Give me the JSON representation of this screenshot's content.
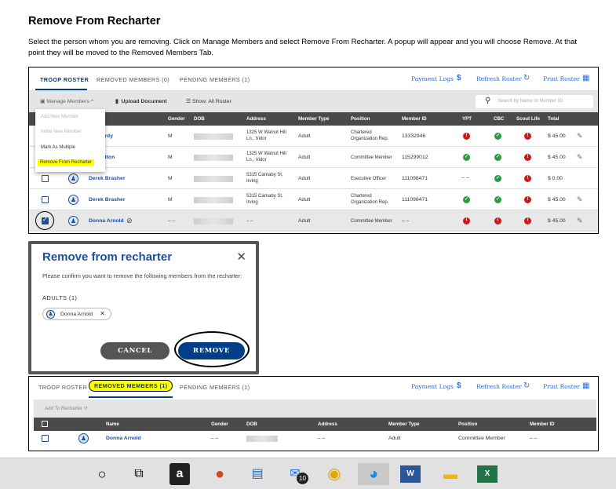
{
  "doc": {
    "title": "Remove From Recharter",
    "instructions": "Select the person whom you are removing. Click on Manage Members and select Remove From Recharter. A popup will appear and you will choose Remove. At that point they will be moved to the Removed Members Tab."
  },
  "roster": {
    "tabs": [
      "TROOP ROSTER",
      "REMOVED MEMBERS (0)",
      "PENDING MEMBERS (1)"
    ],
    "links": [
      "Payment Logs",
      "Refresh Roster",
      "Print Roster"
    ],
    "toolbar": {
      "manage": "Manage Members",
      "upload": "Upload Document",
      "show": "Show: All Roster",
      "search_placeholder": "Search by Name or Member ID"
    },
    "menu": [
      "Add New Member",
      "Invite New Member",
      "Mark As Multiple",
      "Remove From Recharter"
    ],
    "columns": [
      "Gender",
      "DOB",
      "Address",
      "Member Type",
      "Position",
      "Member ID",
      "YPT",
      "CBC",
      "Scout Life",
      "Total"
    ],
    "rows": [
      {
        "name": "...n Hardy",
        "gender": "M",
        "address": "1325 W Walnut Hill Ln., Vidor",
        "type": "Adult",
        "position": "Chartered Organization Rep.",
        "id": "13332946",
        "ypt": "r",
        "cbc": "g",
        "sl": "r",
        "total": "$ 45.00",
        "checked": false,
        "show_cb": false
      },
      {
        "name": "...n Hatton",
        "gender": "M",
        "address": "1325 W Walnut Hill Ln., Vidor",
        "type": "Adult",
        "position": "Committee Member",
        "id": "115299012",
        "ypt": "g",
        "cbc": "g",
        "sl": "r",
        "total": "$ 45.00",
        "checked": false,
        "show_cb": false
      },
      {
        "name": "Derek Brasher",
        "gender": "M",
        "address": "5315 Carnaby St, Irving",
        "type": "Adult",
        "position": "Executive Officer",
        "id": "111098471",
        "ypt": "--",
        "cbc": "g",
        "sl": "r",
        "total": "$ 0.00",
        "checked": false,
        "show_cb": true
      },
      {
        "name": "Derek Brasher",
        "gender": "M",
        "address": "5315 Carnaby St, Irving",
        "type": "Adult",
        "position": "Chartered Organization Rep.",
        "id": "111098471",
        "ypt": "g",
        "cbc": "g",
        "sl": "r",
        "total": "$ 45.00",
        "checked": false,
        "show_cb": true
      },
      {
        "name": "Donna Arnold",
        "gender": "– –",
        "address": "– –",
        "type": "Adult",
        "position": "Committee Member",
        "id": "– –",
        "ypt": "r",
        "cbc": "r",
        "sl": "r",
        "total": "$ 45.00",
        "checked": true,
        "show_cb": true
      }
    ]
  },
  "modal": {
    "title": "Remove from recharter",
    "body": "Please confirm you want to remove the following members from the recharter:",
    "adults_label": "ADULTS (1)",
    "chip": "Donna Arnold",
    "cancel": "CANCEL",
    "remove": "REMOVE"
  },
  "removed": {
    "tabs": [
      "TROOP ROSTER",
      "REMOVED MEMBERS (1)",
      "PENDING MEMBERS (1)"
    ],
    "links": [
      "Payment Logs",
      "Refresh Roster",
      "Print Roster"
    ],
    "add_to_recharter": "Add To Recharter",
    "columns": [
      "Name",
      "Gender",
      "DOB",
      "Address",
      "Member Type",
      "Position",
      "Member ID"
    ],
    "row": {
      "name": "Donna Arnold",
      "gender": "– –",
      "address": "– –",
      "type": "Adult",
      "position": "Committee Member",
      "id": "– –"
    }
  },
  "colors": {
    "brand_blue": "#003f87",
    "highlight": "#ffff00",
    "red": "#d0181b",
    "green": "#2e9a45"
  },
  "taskbar": {
    "icons": [
      "cortana-circle-icon",
      "task-view-icon",
      "amazon-icon",
      "powerpoint-icon",
      "store-icon",
      "mail-icon",
      "chrome-icon",
      "edge-icon",
      "word-icon",
      "file-explorer-icon",
      "excel-icon"
    ],
    "mail_badge": "10"
  }
}
